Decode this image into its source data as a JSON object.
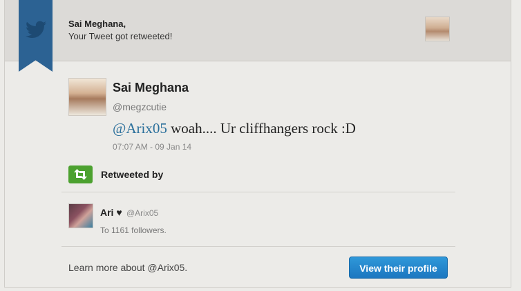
{
  "header": {
    "recipient_name": "Sai Meghana,",
    "message": "Your Tweet got retweeted!"
  },
  "tweet": {
    "author_name": "Sai Meghana",
    "author_handle": "@megzcutie",
    "mention": "@Arix05",
    "text": "woah.... Ur cliffhangers rock :D",
    "timestamp": "07:07 AM - 09 Jan 14"
  },
  "retweet": {
    "label": "Retweeted by",
    "user_name": "Ari ♥",
    "user_handle": "@Arix05",
    "followers_text": "To 1161 followers."
  },
  "footer": {
    "learn_more": "Learn more about @Arix05.",
    "button_label": "View their profile"
  },
  "colors": {
    "ribbon": "#2c6293",
    "link": "#2a6f9b",
    "retweet_green": "#4ca12f",
    "button_blue": "#1c77c0"
  },
  "icons": {
    "ribbon": "twitter-bird-icon",
    "retweet": "retweet-icon"
  }
}
